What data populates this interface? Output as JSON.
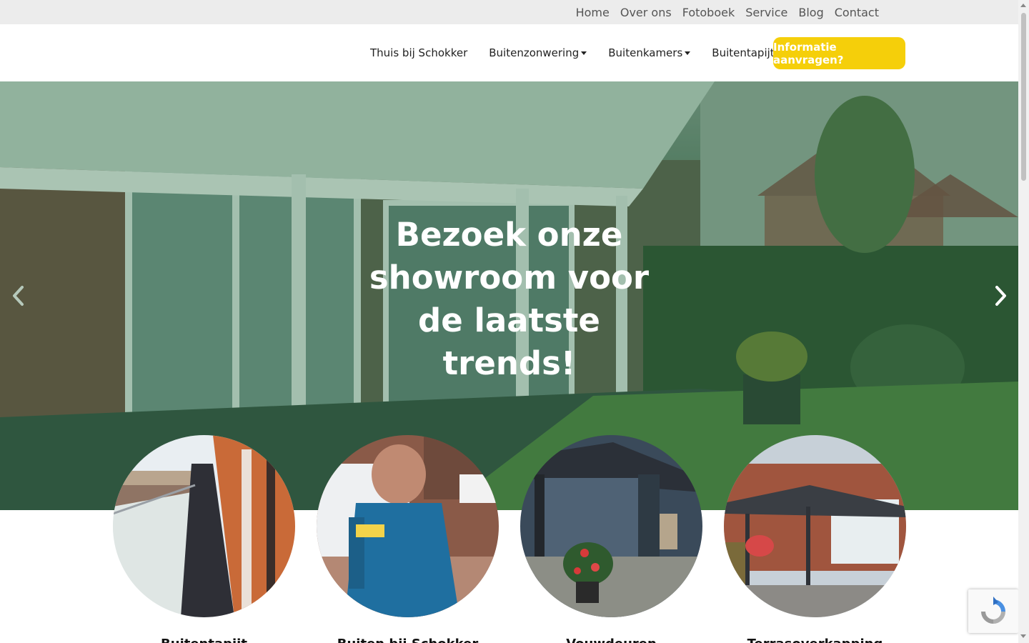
{
  "topbar": {
    "links": [
      "Home",
      "Over ons",
      "Fotoboek",
      "Service",
      "Blog",
      "Contact"
    ]
  },
  "nav": {
    "links": [
      {
        "label": "Thuis bij Schokker",
        "dropdown": false
      },
      {
        "label": "Buitenzonwering",
        "dropdown": true
      },
      {
        "label": "Buitenkamers",
        "dropdown": true
      },
      {
        "label": "Buitentapijt",
        "dropdown": true
      }
    ],
    "cta": "Informatie aanvragen?"
  },
  "hero": {
    "title": "Bezoek onze showroom voor de laatste trends!",
    "prev_icon": "chevron-left-icon",
    "next_icon": "chevron-right-icon"
  },
  "cards": [
    {
      "title": "Buitentapijt",
      "image": "gallery-walkway"
    },
    {
      "title": "Buiten bij Schokker",
      "image": "man-with-van"
    },
    {
      "title": "Vouwdeuren",
      "image": "garden-shed"
    },
    {
      "title": "Terrasoverkapping",
      "image": "patio-cover"
    }
  ],
  "colors": {
    "topbar_bg": "#ececec",
    "cta_bg": "#f5cf0a",
    "hero_overlay": "#2f5a3d"
  },
  "widgets": {
    "recaptcha_icon": "recaptcha-icon"
  }
}
